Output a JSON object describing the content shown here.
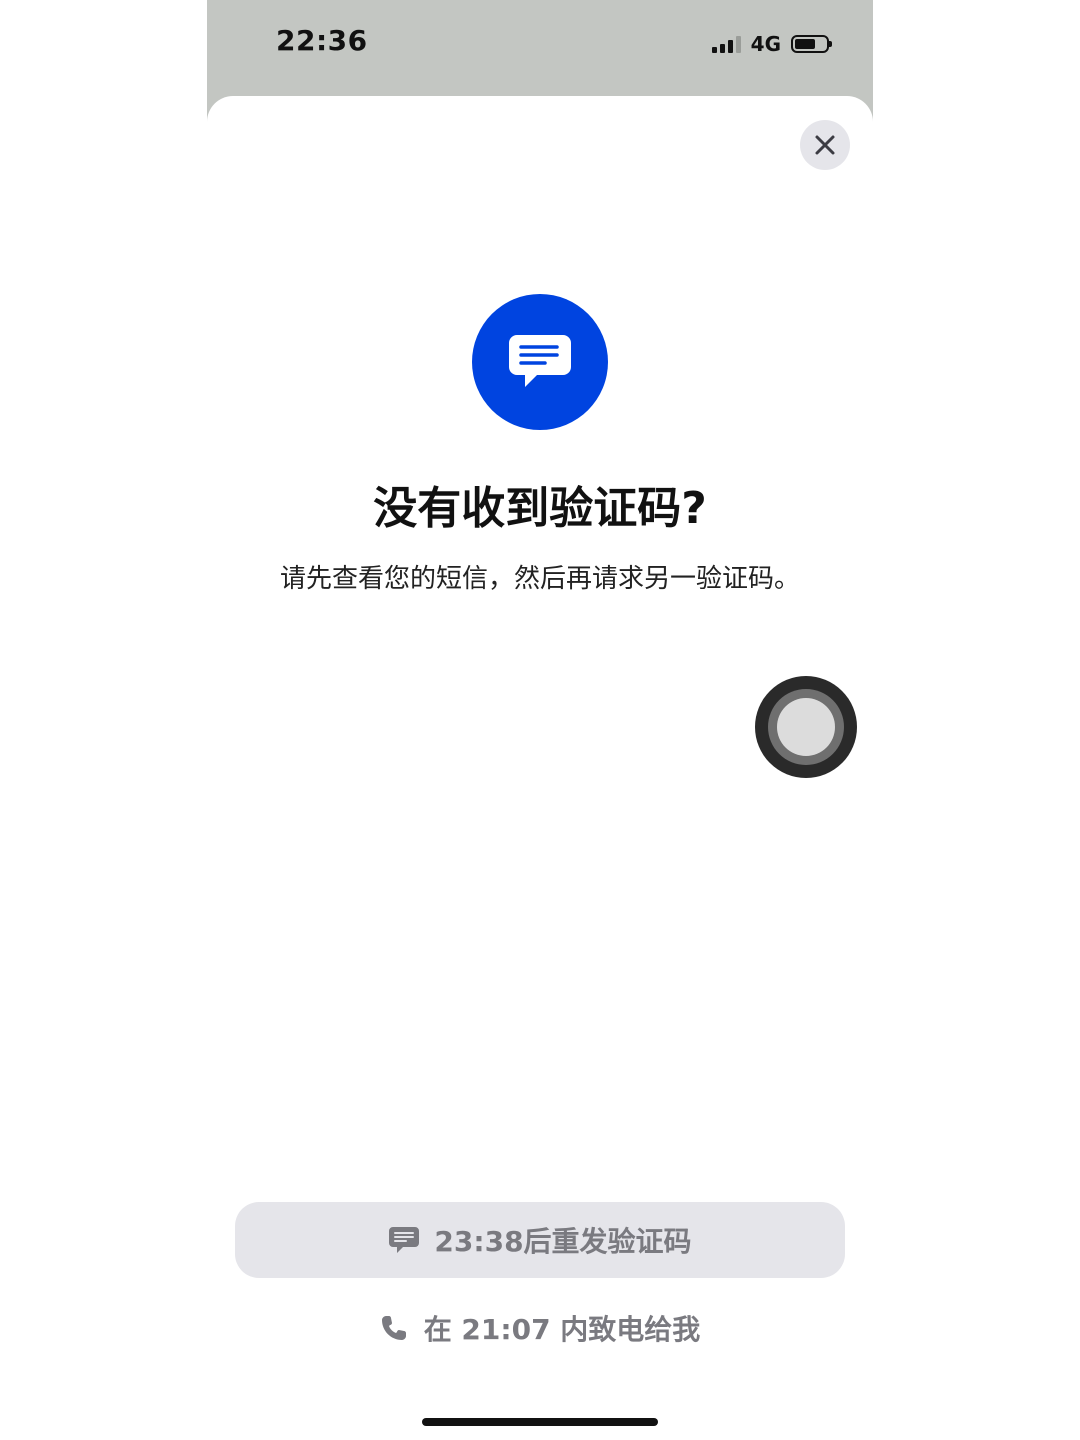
{
  "status_bar": {
    "time": "22:36",
    "network": "4G",
    "battery_level_fraction": 0.65,
    "signal_bars_active": 3,
    "signal_bars_total": 4
  },
  "sheet": {
    "close_icon": "close-icon",
    "badge_icon": "message-bubble-icon",
    "badge_color": "#0044e0",
    "title": "没有收到验证码?",
    "description": "请先查看您的短信，然后再请求另一验证码。"
  },
  "actions": {
    "resend_label": "23:38后重发验证码",
    "resend_icon": "message-icon",
    "call_label": "在 21:07 内致电给我",
    "call_icon": "phone-icon"
  }
}
